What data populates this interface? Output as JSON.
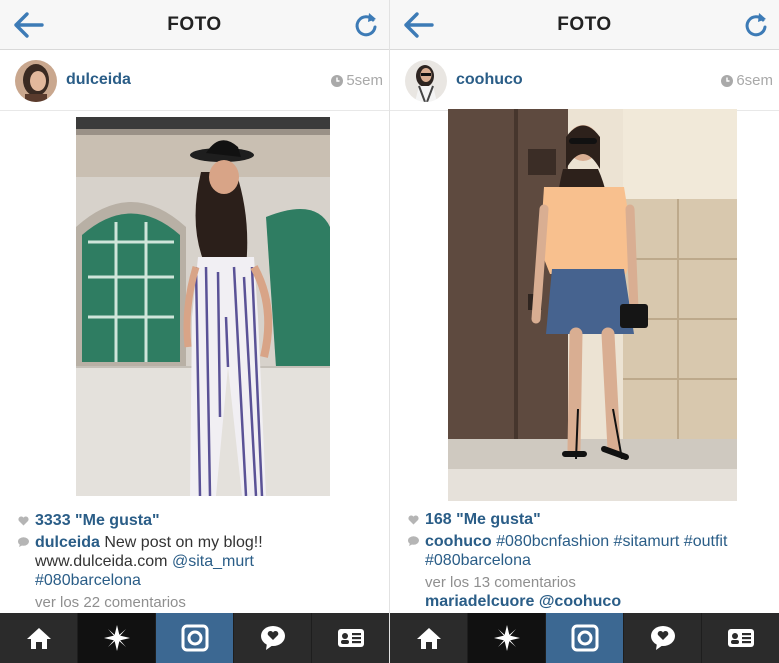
{
  "colors": {
    "link": "#2a5d87",
    "tab_active": "#3c6892",
    "tabbar": "#2b2b2b",
    "nav_icon": "#3d7bb6"
  },
  "left": {
    "nav": {
      "title": "FOTO"
    },
    "user": {
      "name": "dulceida",
      "time": "5sem"
    },
    "likes": "3333 \"Me gusta\"",
    "caption": {
      "user": "dulceida",
      "text": " New post on my blog!! www.dulceida.com ",
      "mention": "@sita_murt",
      "tag": "#080barcelona"
    },
    "view_comments": "ver los 22 comentarios"
  },
  "right": {
    "nav": {
      "title": "FOTO"
    },
    "user": {
      "name": "coohuco",
      "time": "6sem"
    },
    "likes": "168 \"Me gusta\"",
    "caption": {
      "user": "coohuco",
      "tags": "#080bcnfashion #sitamurt #outfit #080barcelona"
    },
    "view_comments": "ver los 13 comentarios",
    "first_comment": "mariadelcuore @coohuco"
  },
  "tabs": [
    "home-icon",
    "explore-icon",
    "camera-icon",
    "activity-icon",
    "profile-icon"
  ]
}
